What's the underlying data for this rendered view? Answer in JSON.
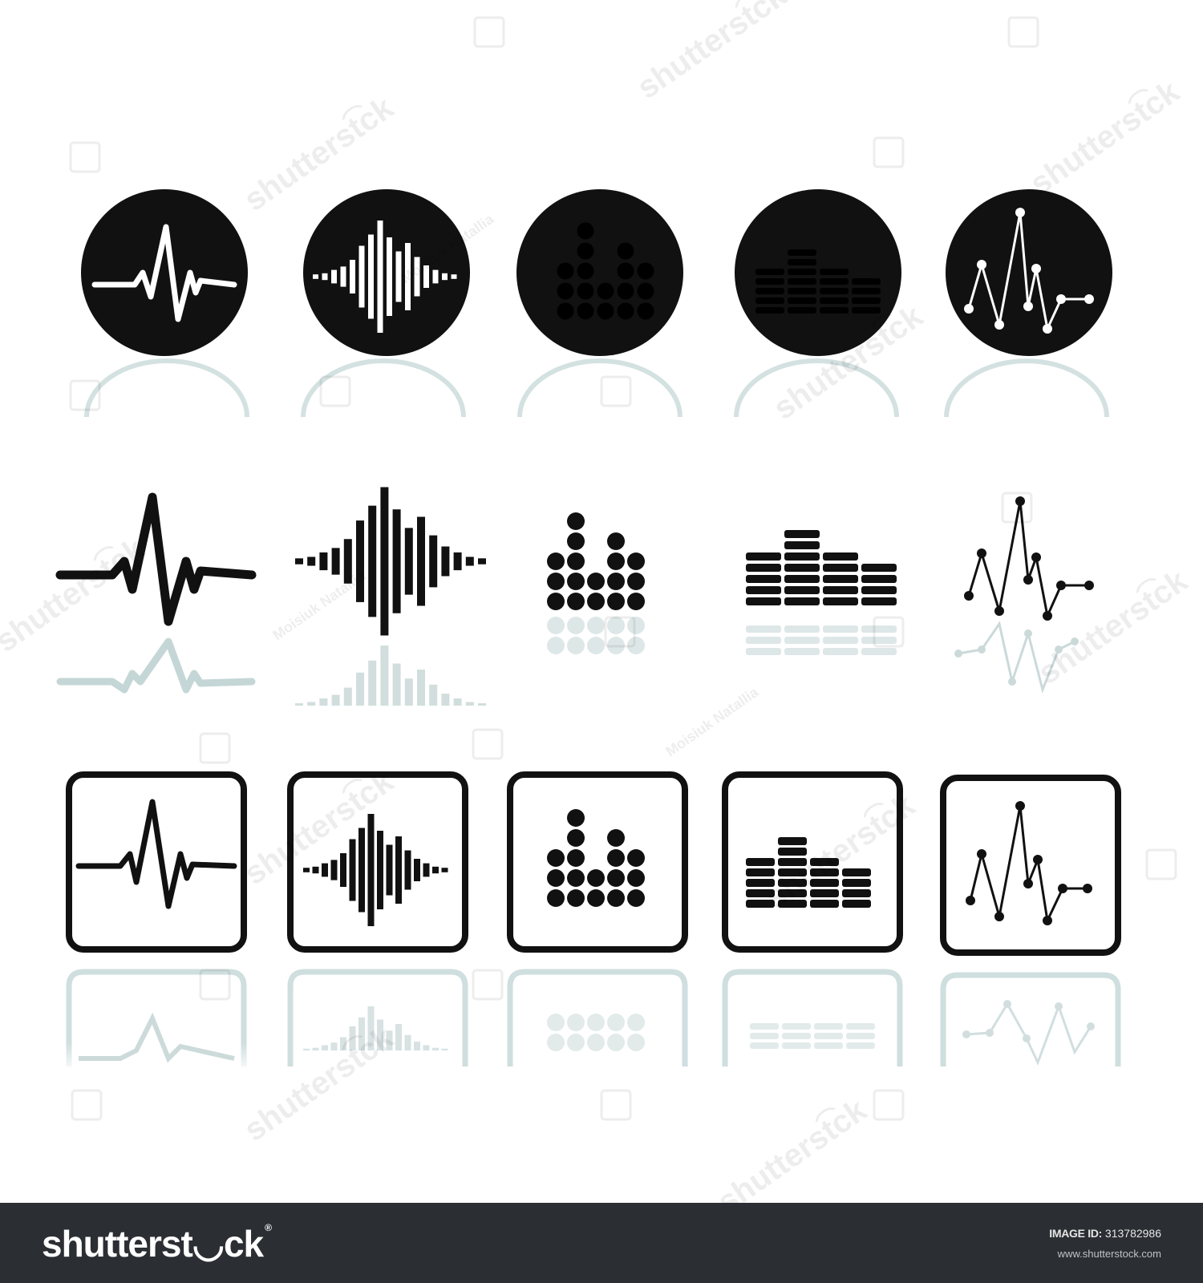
{
  "icon_set": {
    "types": [
      "heartbeat-wave",
      "sound-wave",
      "dot-equalizer",
      "bar-equalizer",
      "line-graph"
    ],
    "styles": [
      "circle-badge",
      "plain-with-reflection",
      "rounded-square-frame"
    ],
    "colors": {
      "icon": "#111111",
      "reflection": "#7fa3a3",
      "background": "#ffffff"
    }
  },
  "watermark": {
    "brand": "shutterst͡ck",
    "author": "Moisiuk Natallia"
  },
  "footer": {
    "logo": "shutterst◡ck",
    "logo_mark": "®",
    "image_id_label": "IMAGE ID:",
    "image_id_value": "313782986",
    "site": "www.shutterstock.com",
    "background": "#2b2e33"
  }
}
